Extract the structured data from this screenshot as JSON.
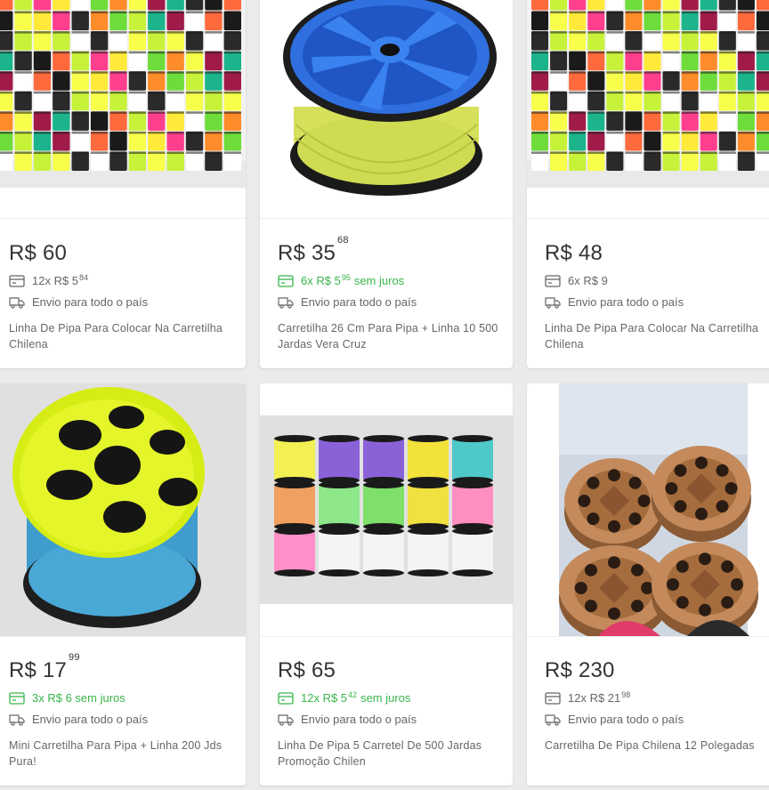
{
  "products": [
    {
      "price": "R$ 60",
      "cents": "",
      "installment_prefix": "12x R$ 5",
      "installment_cents": "84",
      "installment_suffix": "",
      "installment_green": false,
      "shipping": "Envio para todo o país",
      "title": "Linha De Pipa Para Colocar Na Carretilha Chilena"
    },
    {
      "price": "R$ 35",
      "cents": "68",
      "installment_prefix": "6x R$ 5",
      "installment_cents": "95",
      "installment_suffix": "sem juros",
      "installment_green": true,
      "shipping": "Envio para todo o país",
      "title": "Carretilha 26 Cm Para Pipa + Linha 10 500 Jardas Vera Cruz"
    },
    {
      "price": "R$ 48",
      "cents": "",
      "installment_prefix": "6x R$ 9",
      "installment_cents": "",
      "installment_suffix": "",
      "installment_green": false,
      "shipping": "Envio para todo o país",
      "title": "Linha De Pipa Para Colocar Na Carretilha Chilena"
    },
    {
      "price": "R$ 17",
      "cents": "99",
      "installment_prefix": "3x R$ 6 sem juros",
      "installment_cents": "",
      "installment_suffix": "",
      "installment_green": true,
      "shipping": "Envio para todo o país",
      "title": "Mini Carretilha Para Pipa + Linha 200 Jds Pura!"
    },
    {
      "price": "R$ 65",
      "cents": "",
      "installment_prefix": "12x R$ 5",
      "installment_cents": "42",
      "installment_suffix": "sem juros",
      "installment_green": true,
      "shipping": "Envio para todo o país",
      "title": "Linha De Pipa 5 Carretel De 500 Jardas Promoção Chilen"
    },
    {
      "price": "R$ 230",
      "cents": "",
      "installment_prefix": "12x R$ 21",
      "installment_cents": "98",
      "installment_suffix": "",
      "installment_green": false,
      "shipping": "Envio para todo o país",
      "title": "Carretilha De Pipa Chilena 12 Polegadas"
    }
  ],
  "colors": {
    "green": "#39b54a",
    "text": "#333333",
    "muted": "#666666",
    "background": "#ebebeb"
  },
  "icons": {
    "installment": "credit-card-icon",
    "shipping": "delivery-truck-icon"
  }
}
